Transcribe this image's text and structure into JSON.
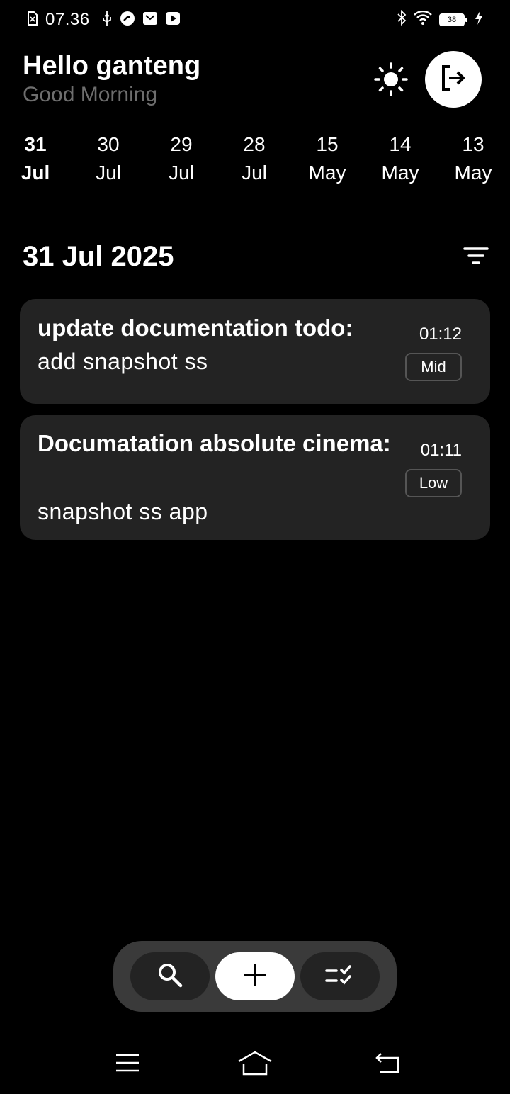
{
  "status_bar": {
    "time": "07.36",
    "battery": "38",
    "icons_left": [
      "sim-off-icon",
      "usb-icon",
      "app-notification-icon",
      "mail-icon",
      "youtube-icon"
    ],
    "icons_right": [
      "bluetooth-icon",
      "wifi-icon",
      "battery-icon",
      "charging-icon"
    ]
  },
  "header": {
    "greeting": "Hello ganteng",
    "subtitle": "Good Morning"
  },
  "dates": [
    {
      "day": "31",
      "month": "Jul",
      "active": true
    },
    {
      "day": "30",
      "month": "Jul"
    },
    {
      "day": "29",
      "month": "Jul"
    },
    {
      "day": "28",
      "month": "Jul"
    },
    {
      "day": "15",
      "month": "May"
    },
    {
      "day": "14",
      "month": "May"
    },
    {
      "day": "13",
      "month": "May"
    }
  ],
  "section": {
    "date": "31 Jul 2025"
  },
  "tasks": [
    {
      "title": "update documentation todo:",
      "description": "add snapshot ss",
      "time": "01:12",
      "priority": "Mid"
    },
    {
      "title": "Documatation absolute cinema:",
      "description": "snapshot ss app",
      "time": "01:11",
      "priority": "Low"
    }
  ],
  "colors": {
    "background": "#000000",
    "card": "#232323",
    "subtitle": "#6e6e6e",
    "nav_bar": "#3a3a3a"
  }
}
